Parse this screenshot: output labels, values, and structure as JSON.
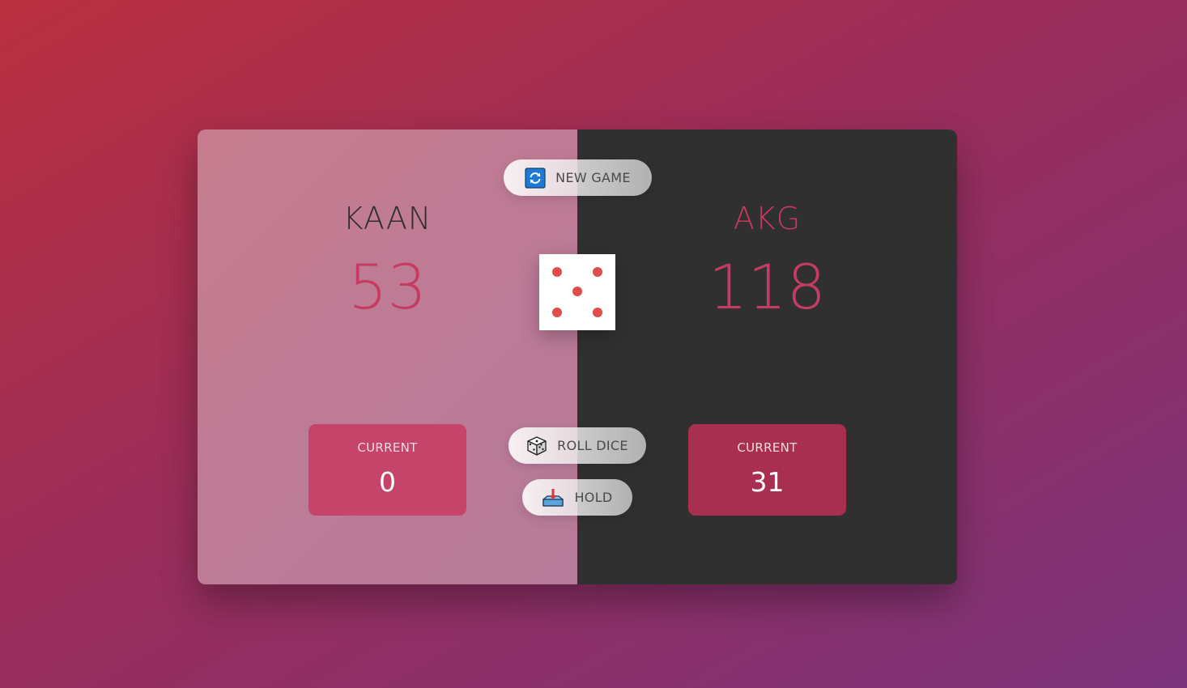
{
  "players": [
    {
      "name": "KAAN",
      "score": "53",
      "current_label": "CURRENT",
      "current_value": "0",
      "active": true
    },
    {
      "name": "AKG",
      "score": "118",
      "current_label": "CURRENT",
      "current_value": "31",
      "active": false
    }
  ],
  "buttons": {
    "new_game": "NEW GAME",
    "roll_dice": "ROLL DICE",
    "hold": "HOLD"
  },
  "dice": {
    "value": 5,
    "pip_color": "#e04b4b"
  },
  "colors": {
    "accent": "#c73b63",
    "active_panel": "#c67c8e",
    "inactive_panel": "#303030",
    "current_box_active": "#c6436a",
    "current_box_inactive": "#a92f50"
  },
  "icons": {
    "new_game": "refresh-icon",
    "roll_dice": "dice-icon",
    "hold": "inbox-tray-icon"
  }
}
